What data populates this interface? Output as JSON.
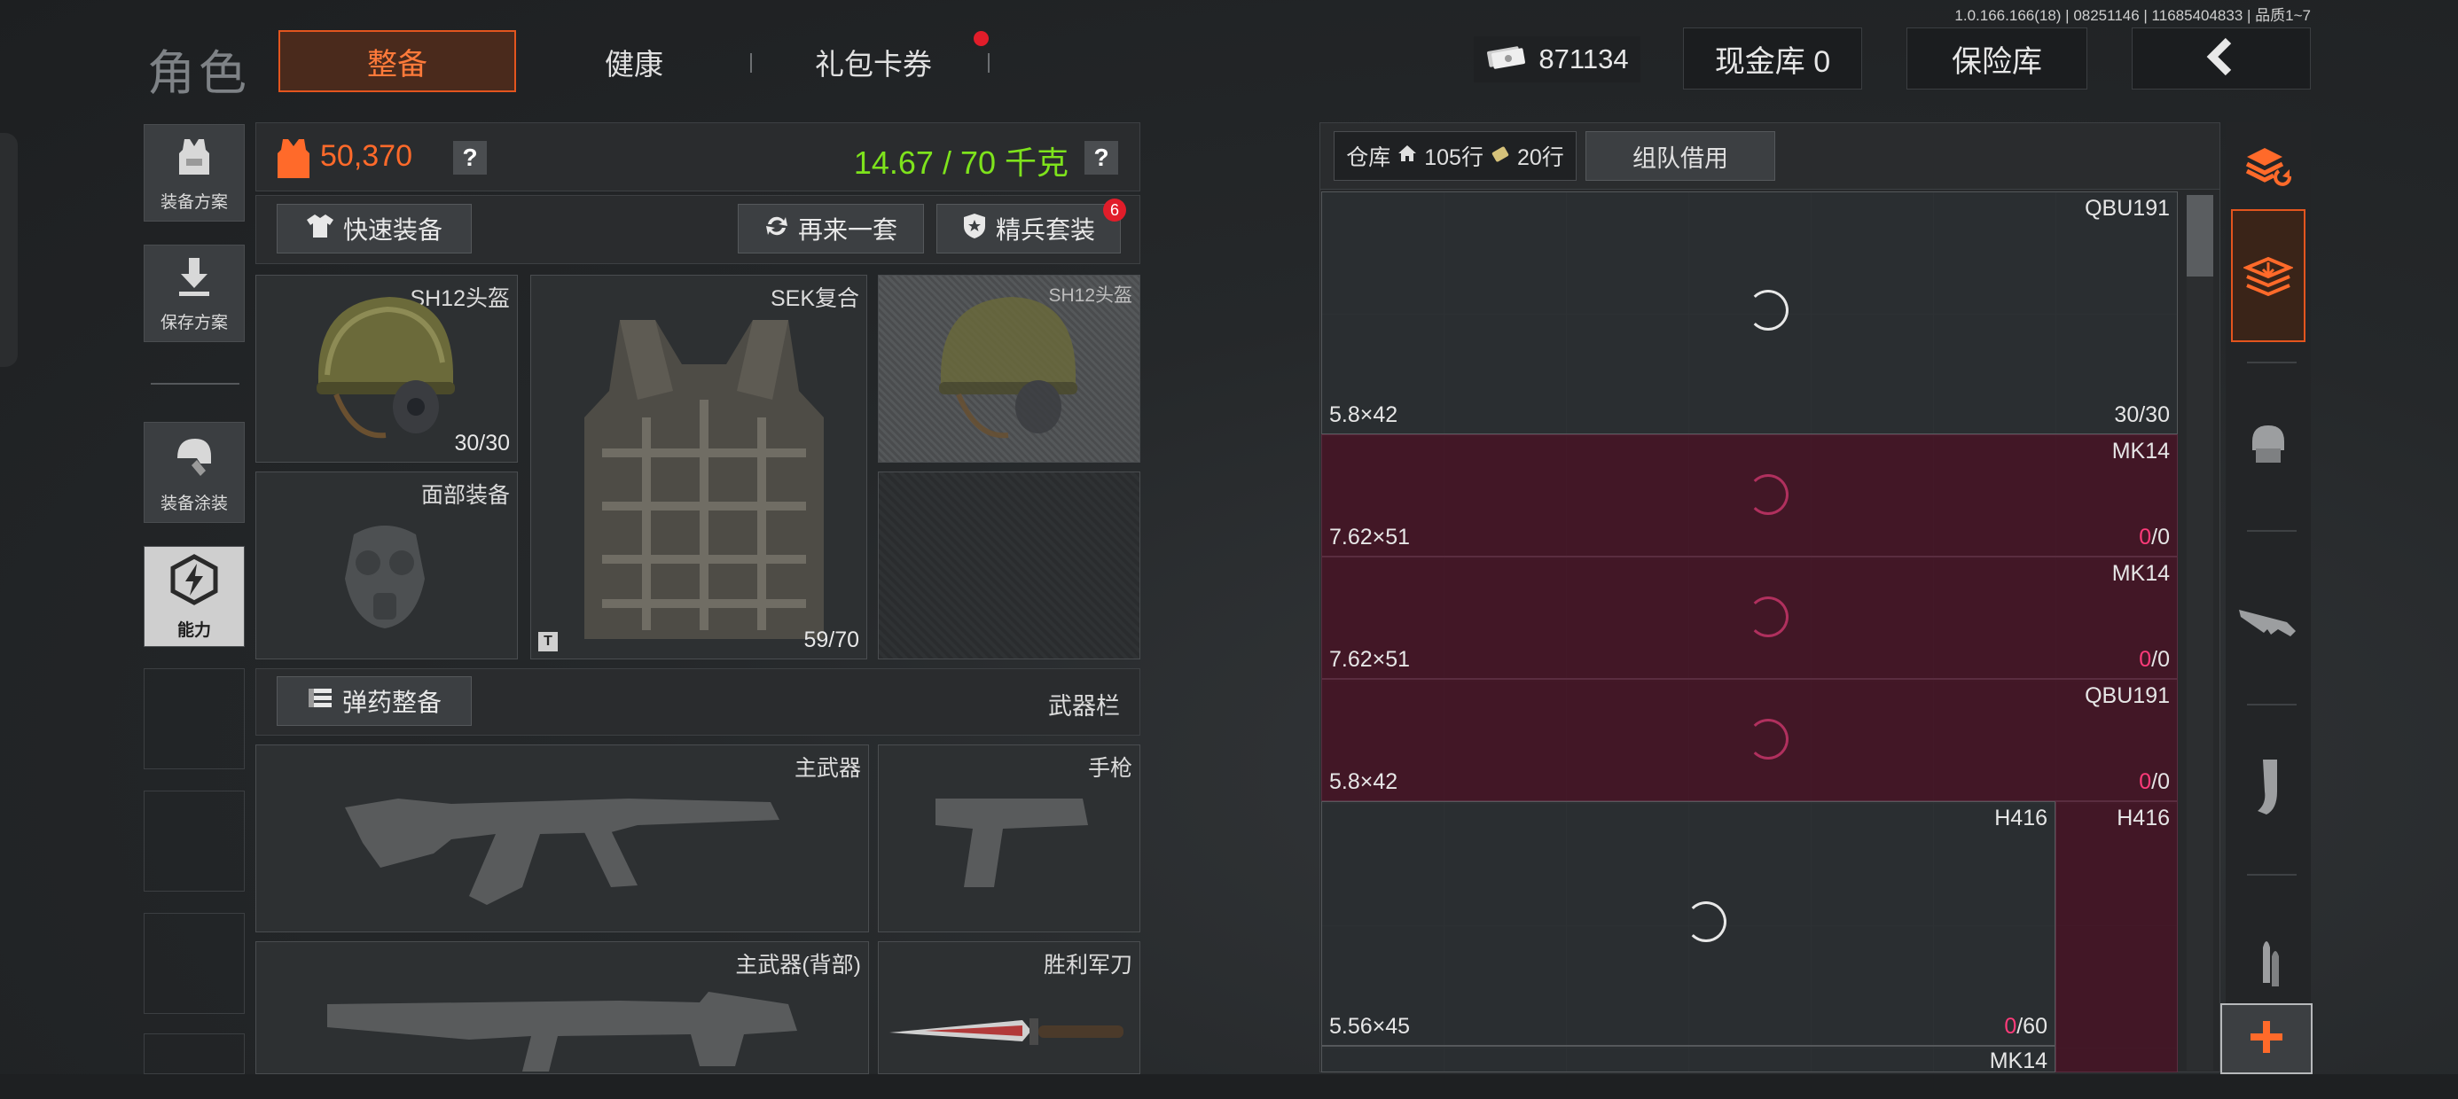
{
  "version_text": "1.0.166.166(18) | 08251146 | 11685404833 | 品质1~7",
  "header": {
    "role_title": "角色",
    "tabs": [
      {
        "label": "整备",
        "active": true
      },
      {
        "label": "健康",
        "active": false
      },
      {
        "label": "礼包卡券",
        "active": false,
        "has_notification_dot": true
      }
    ],
    "money": "871134",
    "cash_vault": "现金库 0",
    "insurance": "保险库"
  },
  "side_menu": {
    "items": [
      {
        "label": "装备方案",
        "icon": "vest-icon"
      },
      {
        "label": "保存方案",
        "icon": "download-icon"
      },
      {
        "label": "装备涂装",
        "icon": "helmet-paint-icon"
      },
      {
        "label": "能力",
        "icon": "lightning-hex-icon",
        "selected": true
      }
    ]
  },
  "stats": {
    "armor_value": "50,370",
    "weight": "14.67 / 70 千克",
    "help_mark": "?"
  },
  "actions": {
    "quick_equip": "快速装备",
    "another_set": "再来一套",
    "elite_set": "精兵套装",
    "elite_badge": "6",
    "ammo_setup": "弹药整备",
    "weapon_bar": "武器栏"
  },
  "gear_slots": {
    "helmet": {
      "label": "SH12头盔",
      "count": "30/30"
    },
    "armor": {
      "label": "SEK复合",
      "count": "59/70",
      "tag": "T"
    },
    "helmet_compare": {
      "label": "SH12头盔"
    },
    "face": {
      "label": "面部装备"
    },
    "primary": {
      "label": "主武器"
    },
    "pistol": {
      "label": "手枪"
    },
    "primary_back": {
      "label": "主武器(背部)"
    },
    "knife": {
      "label": "胜利军刀"
    }
  },
  "warehouse": {
    "tab_label": "仓库",
    "rows_a": "105行",
    "rows_b": "20行",
    "team_borrow": "组队借用",
    "items": [
      {
        "name": "QBU191",
        "caliber": "5.8×42",
        "ammo_cur": "30",
        "ammo_max": "/30",
        "state": "ok"
      },
      {
        "name": "MK14",
        "caliber": "7.62×51",
        "ammo_cur": "0",
        "ammo_max": "/0",
        "state": "bad"
      },
      {
        "name": "MK14",
        "caliber": "7.62×51",
        "ammo_cur": "0",
        "ammo_max": "/0",
        "state": "bad"
      },
      {
        "name": "QBU191",
        "caliber": "5.8×42",
        "ammo_cur": "0",
        "ammo_max": "/0",
        "state": "bad"
      },
      {
        "name": "H416",
        "caliber": "5.56×45",
        "ammo_cur": "0",
        "ammo_max": "/60",
        "state": "ok"
      },
      {
        "name": "H416",
        "caliber": "",
        "ammo_cur": "",
        "ammo_max": "",
        "state": "bad"
      },
      {
        "name": "MK14",
        "caliber": "",
        "ammo_cur": "",
        "ammo_max": "",
        "state": "ok"
      }
    ]
  },
  "right_rail": {
    "items": [
      "stack-refresh-icon",
      "stack-download-icon",
      "vest-icon",
      "rifle-icon",
      "magazine-icon",
      "bullet-icon",
      "plus-icon"
    ]
  },
  "colors": {
    "accent_orange": "#e3551e",
    "weight_green": "#7ee31c",
    "invalid_pink": "#ff3b7a",
    "invalid_bg": "#441626"
  }
}
